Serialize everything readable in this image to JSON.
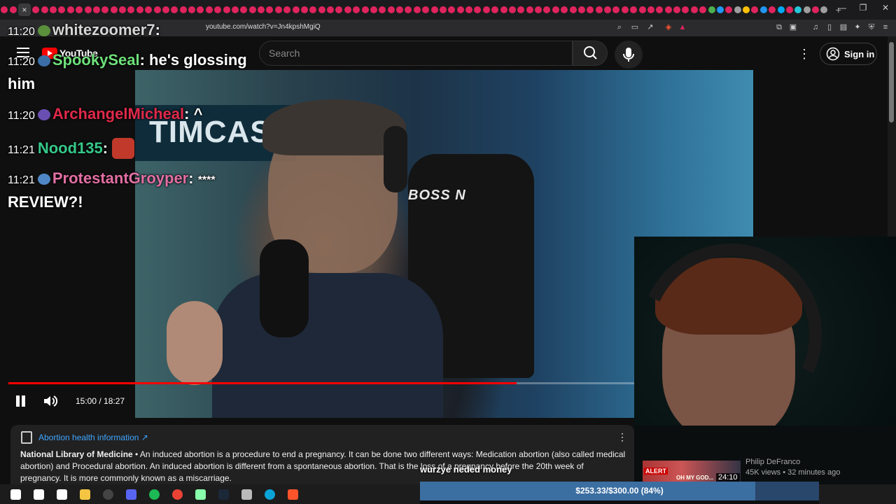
{
  "browser": {
    "tab_close": "×",
    "new_tab": "+",
    "url": "youtube.com/watch?v=Jn4kpshMgiQ",
    "window_controls": [
      "—",
      "❐",
      "✕"
    ],
    "tab_colors": [
      "#e0245e",
      "#e0245e",
      "#e0245e",
      "#e0245e",
      "#e0245e",
      "#e0245e",
      "#e0245e",
      "#e0245e",
      "#e0245e",
      "#e0245e",
      "#e0245e",
      "#e0245e",
      "#e0245e",
      "#e0245e",
      "#e0245e",
      "#e0245e",
      "#e0245e",
      "#e0245e",
      "#e0245e",
      "#e0245e",
      "#e0245e",
      "#e0245e",
      "#e0245e",
      "#e0245e",
      "#e0245e",
      "#e0245e",
      "#e0245e",
      "#e0245e",
      "#e0245e",
      "#e0245e",
      "#e0245e",
      "#e0245e",
      "#e0245e",
      "#e0245e",
      "#e0245e",
      "#e0245e",
      "#e0245e",
      "#e0245e",
      "#e0245e",
      "#e0245e",
      "#e0245e",
      "#e0245e",
      "#e0245e",
      "#e0245e",
      "#e0245e",
      "#e0245e",
      "#e0245e",
      "#e0245e",
      "#e0245e",
      "#e0245e",
      "#e0245e",
      "#e0245e",
      "#e0245e",
      "#e0245e",
      "#e0245e",
      "#e0245e",
      "#e0245e",
      "#e0245e",
      "#e0245e",
      "#e0245e",
      "#e0245e",
      "#e0245e",
      "#e0245e",
      "#e0245e",
      "#e0245e",
      "#e0245e",
      "#e0245e",
      "#e0245e",
      "#e0245e",
      "#e0245e",
      "#e0245e",
      "#e0245e",
      "#e0245e",
      "#e0245e",
      "#e0245e",
      "#e0245e",
      "#e0245e",
      "#e0245e",
      "#e0245e",
      "#e0245e",
      "#4caf50",
      "#2196f3",
      "#e0245e",
      "#9e9e9e",
      "#ffc107",
      "#e0245e",
      "#2196f3",
      "#e0245e",
      "#03a9f4",
      "#e0245e",
      "#26c6da",
      "#9e9e9e",
      "#e0245e",
      "#9e9e9e"
    ]
  },
  "youtube": {
    "logo_text": "YouTube",
    "search_placeholder": "Search",
    "sign_in": "Sign in",
    "more_icon": "⋮"
  },
  "video": {
    "sign_text": "TIMCAST",
    "chair_logo": "BOSS N",
    "time_display": "15:00 / 18:27",
    "progress": 0.8116
  },
  "chat": [
    {
      "ts": "11:20",
      "user": "whitezoomer7",
      "user_color": "#d6d6d6",
      "badge_color": "#5a8f3c",
      "msg": ""
    },
    {
      "ts": "11:20",
      "user": "SpookySeal",
      "user_color": "#6ee07a",
      "badge_color": "#3a6ea5",
      "msg": "he's glossing"
    },
    {
      "ts": "",
      "user": "",
      "user_color": "#fff",
      "badge_color": "",
      "msg": "him"
    },
    {
      "ts": "11:20",
      "user": "ArchangelMicheal",
      "user_color": "#e0294a",
      "badge_color": "#6a4fb3",
      "msg": "^"
    },
    {
      "ts": "11:21",
      "user": "Nood135",
      "user_color": "#35c98a",
      "badge_color": "#c0392b",
      "msg": ""
    },
    {
      "ts": "11:21",
      "user": "ProtestantGroyper",
      "user_color": "#e26fa3",
      "badge_color": "#4f86c6",
      "msg": "****"
    },
    {
      "ts": "",
      "user": "",
      "user_color": "#fff",
      "badge_color": "",
      "msg": "REVIEW?!"
    }
  ],
  "info_panel": {
    "title": "Abortion health information ↗",
    "source": "National Library of Medicine",
    "body": " • An induced abortion is a procedure to end a pregnancy. It can be done two different ways: Medication abortion (also called medical abortion) and Procedural abortion. An induced abortion is different from a spontaneous abortion. That is the loss of a pregnancy before the 20th week of pregnancy. It is more commonly known as a miscarriage.",
    "more_icon": "⋮"
  },
  "recommendation": {
    "alert_label": "ALERT",
    "thumb_text": "OH MY GOD...",
    "duration": "24:10",
    "channel": "Philip DeFranco",
    "meta": "45K views • 32 minutes ago"
  },
  "donation": {
    "message": "wurzye neded money",
    "goal_text": "$253.33/$300.00 (84%)",
    "goal_fraction": 0.84
  },
  "taskbar": {
    "icons": [
      {
        "name": "windows-start-icon",
        "color": "#ffffff"
      },
      {
        "name": "search-icon",
        "color": "#ffffff"
      },
      {
        "name": "task-view-icon",
        "color": "#ffffff"
      },
      {
        "name": "file-explorer-icon",
        "color": "#f4c542"
      },
      {
        "name": "obs-icon",
        "color": "#444444"
      },
      {
        "name": "discord-icon",
        "color": "#5865f2"
      },
      {
        "name": "spotify-icon",
        "color": "#1db954"
      },
      {
        "name": "chrome-icon",
        "color": "#ea4335"
      },
      {
        "name": "app-icon",
        "color": "#8fa"
      },
      {
        "name": "steam-icon",
        "color": "#1b2838"
      },
      {
        "name": "app2-icon",
        "color": "#bbbbbb"
      },
      {
        "name": "edge-icon",
        "color": "#0aa3d8"
      },
      {
        "name": "brave-icon",
        "color": "#fb542b"
      }
    ]
  }
}
